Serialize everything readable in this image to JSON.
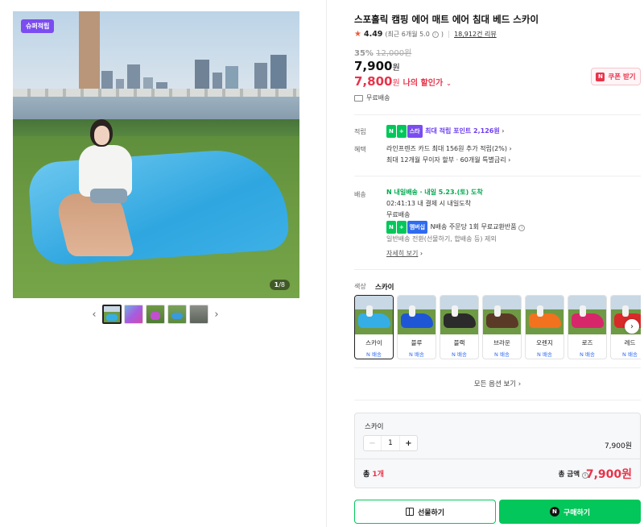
{
  "gallery": {
    "badge": "슈퍼적립",
    "counter_current": "1",
    "counter_total": "/8",
    "prev_arrow": "‹",
    "next_arrow": "›"
  },
  "product": {
    "title": "스포홀릭 캠핑 에어 매트 에어 침대 베드 스카이",
    "rating_star": "★",
    "rating_score": "4.49",
    "rating_sub": "(최근 6개월 5.0",
    "rating_sub_end": ")",
    "reviews": "18,912건 리뷰",
    "discount_rate": "35%",
    "original_price": "12,000원",
    "price_number": "7,900",
    "price_unit": "원",
    "my_price_number": "7,800",
    "my_price_unit": "원",
    "my_price_label": "나의 할인가",
    "coupon_label": "쿠폰 받기",
    "coupon_logo": "N",
    "shipping_free": "무료배송"
  },
  "benefits": {
    "point_label": "적립",
    "point_tag1": "N",
    "point_tag2": "+",
    "point_tag3": "스타",
    "point_text": "최대 적립 포인트 2,126원",
    "benefit_label": "혜택",
    "benefit_line1": "라인프렌즈 카드 최대 156원 추가 적립(2%)",
    "benefit_line2": "최대 12개월 무이자 할부 · 60개월 특별금리",
    "delivery_label": "배송",
    "delivery_tag": "N 내일배송",
    "delivery_date": "· 내일 5.23.(토) 도착",
    "delivery_cutoff": "02:41:13  내 결제 시 내일도착",
    "delivery_free": "무료배송",
    "return_tag1": "N",
    "return_tag2": "+",
    "return_tag3": "멤버십",
    "return_text": "N배송 주문당 1회 무료교환반품",
    "excluded": "일반배송 전환(선물하기, 합배송 등) 제외",
    "detail_link": "자세히 보기"
  },
  "options": {
    "color_label": "색상",
    "color_value": "스카이",
    "swatches": [
      {
        "name": "스카이",
        "ship": "N 배송",
        "color": "#35aee6"
      },
      {
        "name": "블루",
        "ship": "N 배송",
        "color": "#1f56d6"
      },
      {
        "name": "블랙",
        "ship": "N 배송",
        "color": "#2b2b2b"
      },
      {
        "name": "브라운",
        "ship": "N 배송",
        "color": "#5a3a26"
      },
      {
        "name": "오렌지",
        "ship": "N 배송",
        "color": "#f2721e"
      },
      {
        "name": "로즈",
        "ship": "N 배송",
        "color": "#d8266a"
      },
      {
        "name": "레드",
        "ship": "N 배송",
        "color": "#d92a2a"
      }
    ],
    "all_options": "모든 옵션 보기 ›"
  },
  "selection": {
    "item_name": "스카이",
    "minus": "−",
    "quantity": "1",
    "plus": "+",
    "item_price": "7,900원",
    "total_prefix": "총 ",
    "total_count": "1개",
    "total_label": "총 금액",
    "total_price": "7,900원"
  },
  "actions": {
    "gift_label": "선물하기",
    "buy_label": "구매하기",
    "buy_logo": "N"
  }
}
